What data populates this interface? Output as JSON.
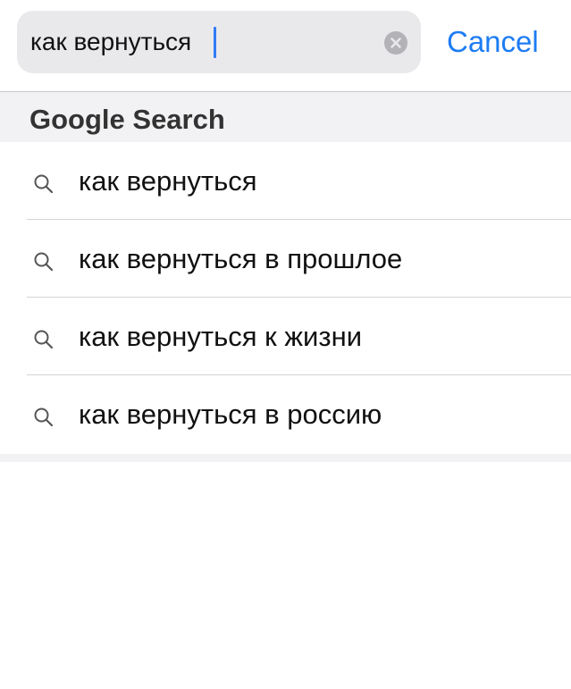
{
  "search": {
    "query": "как вернуться",
    "cancel_label": "Cancel"
  },
  "section": {
    "title": "Google Search"
  },
  "suggestions": [
    {
      "text": "как вернуться"
    },
    {
      "text": "как вернуться в прошлое"
    },
    {
      "text": "как вернуться к жизни"
    },
    {
      "text": "как вернуться в россию"
    }
  ],
  "colors": {
    "accent": "#1d7cf3",
    "field_bg": "#e9e9ec",
    "header_bg": "#f2f2f4"
  },
  "icons": {
    "clear": "clear-circle-x-icon",
    "suggestion": "magnifier-icon"
  }
}
